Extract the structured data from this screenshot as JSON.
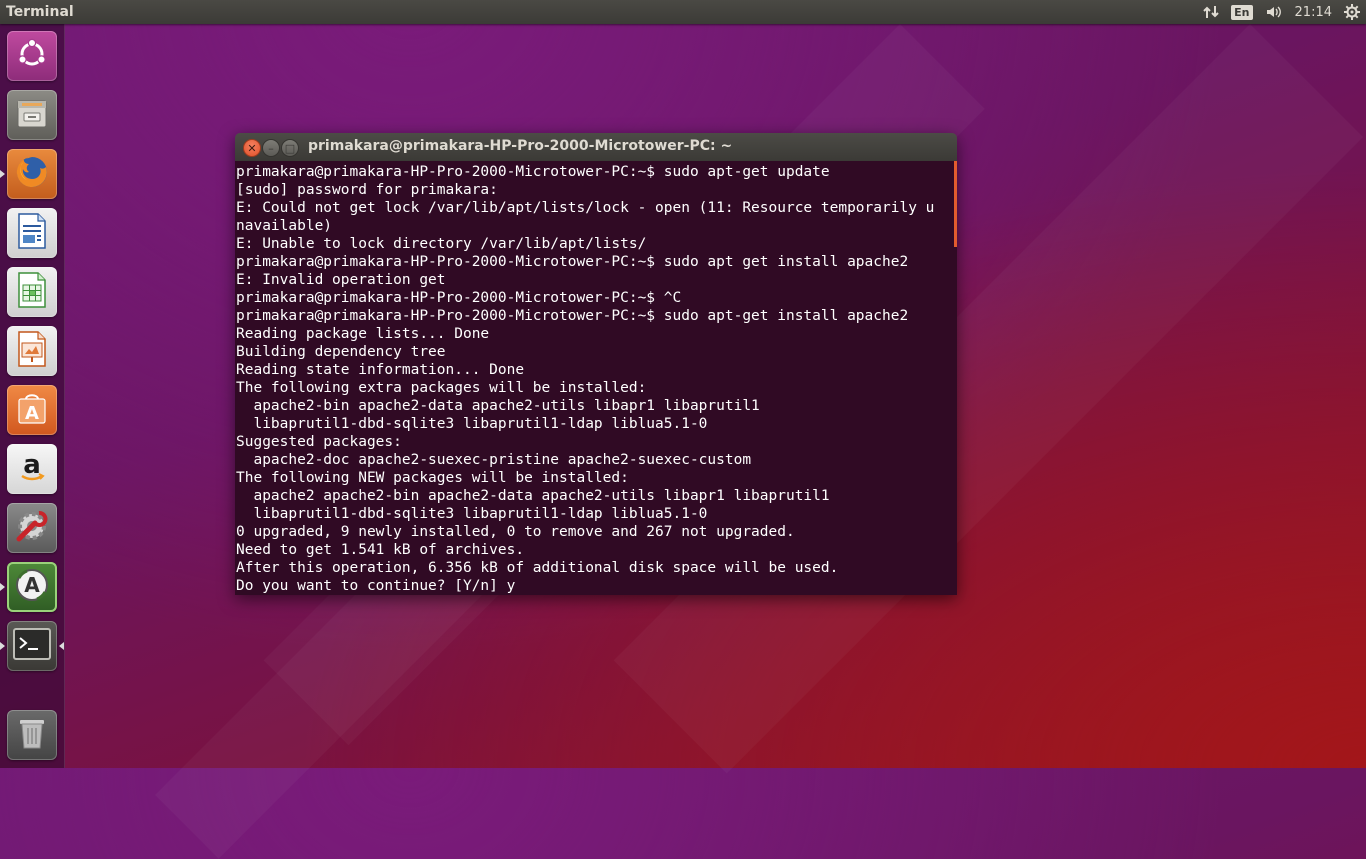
{
  "top_panel": {
    "app_title": "Terminal",
    "indicators": {
      "network_icon": "network-arrows-icon",
      "keyboard_layout": "En",
      "volume_icon": "volume-icon",
      "clock": "21:14",
      "session_icon": "gear-icon"
    }
  },
  "launcher": {
    "items": [
      {
        "name": "ubuntu-dash",
        "icon": "ubuntu-logo-icon",
        "color": "#a83b8f"
      },
      {
        "name": "files",
        "icon": "file-cabinet-icon",
        "color": "#8b8a84"
      },
      {
        "name": "firefox",
        "icon": "firefox-icon",
        "color": "#e8733a"
      },
      {
        "name": "libreoffice-writer",
        "icon": "writer-document-icon",
        "color": "#2c5a9e"
      },
      {
        "name": "libreoffice-calc",
        "icon": "calc-spreadsheet-icon",
        "color": "#3d8f3a"
      },
      {
        "name": "libreoffice-impress",
        "icon": "impress-presentation-icon",
        "color": "#c2571b"
      },
      {
        "name": "ubuntu-software-center",
        "icon": "shopping-bag-icon",
        "color": "#e8743a"
      },
      {
        "name": "amazon",
        "icon": "amazon-icon",
        "color": "#ececec"
      },
      {
        "name": "system-settings",
        "icon": "settings-wrench-icon",
        "color": "#6d6d6d"
      },
      {
        "name": "software-updater",
        "icon": "software-updater-icon",
        "color": "#3d6e2d"
      },
      {
        "name": "terminal",
        "icon": "terminal-icon",
        "color": "#3c3b37"
      },
      {
        "name": "trash",
        "icon": "trash-icon",
        "color": "#5a5a5a"
      }
    ]
  },
  "terminal": {
    "title": "primakara@primakara-HP-Pro-2000-Microtower-PC: ~",
    "output": "primakara@primakara-HP-Pro-2000-Microtower-PC:~$ sudo apt-get update\n[sudo] password for primakara:\nE: Could not get lock /var/lib/apt/lists/lock - open (11: Resource temporarily u\nnavailable)\nE: Unable to lock directory /var/lib/apt/lists/\nprimakara@primakara-HP-Pro-2000-Microtower-PC:~$ sudo apt get install apache2\nE: Invalid operation get\nprimakara@primakara-HP-Pro-2000-Microtower-PC:~$ ^C\nprimakara@primakara-HP-Pro-2000-Microtower-PC:~$ sudo apt-get install apache2\nReading package lists... Done\nBuilding dependency tree\nReading state information... Done\nThe following extra packages will be installed:\n  apache2-bin apache2-data apache2-utils libapr1 libaprutil1\n  libaprutil1-dbd-sqlite3 libaprutil1-ldap liblua5.1-0\nSuggested packages:\n  apache2-doc apache2-suexec-pristine apache2-suexec-custom\nThe following NEW packages will be installed:\n  apache2 apache2-bin apache2-data apache2-utils libapr1 libaprutil1\n  libaprutil1-dbd-sqlite3 libaprutil1-ldap liblua5.1-0\n0 upgraded, 9 newly installed, 0 to remove and 267 not upgraded.\nNeed to get 1.541 kB of archives.\nAfter this operation, 6.356 kB of additional disk space will be used.\nDo you want to continue? [Y/n] y"
  }
}
